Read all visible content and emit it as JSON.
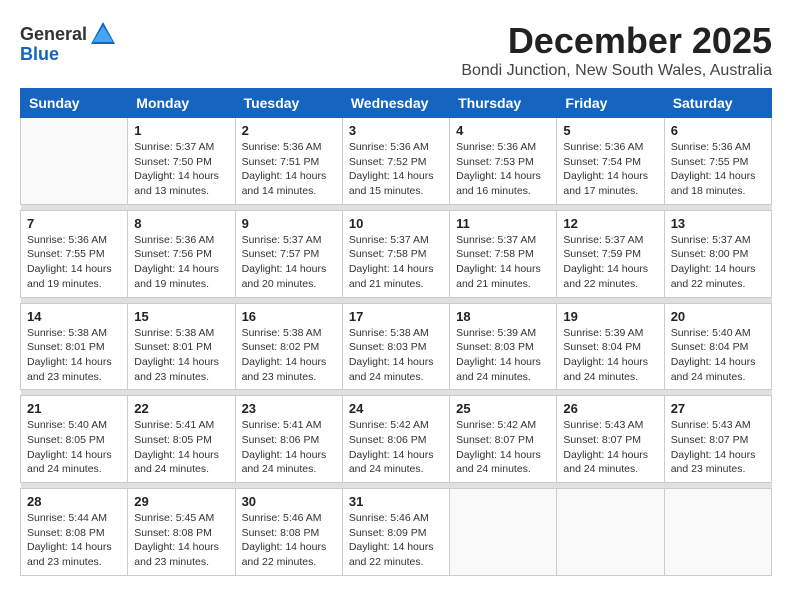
{
  "logo": {
    "general": "General",
    "blue": "Blue"
  },
  "title": "December 2025",
  "subtitle": "Bondi Junction, New South Wales, Australia",
  "headers": [
    "Sunday",
    "Monday",
    "Tuesday",
    "Wednesday",
    "Thursday",
    "Friday",
    "Saturday"
  ],
  "weeks": [
    [
      {
        "day": "",
        "info": ""
      },
      {
        "day": "1",
        "info": "Sunrise: 5:37 AM\nSunset: 7:50 PM\nDaylight: 14 hours\nand 13 minutes."
      },
      {
        "day": "2",
        "info": "Sunrise: 5:36 AM\nSunset: 7:51 PM\nDaylight: 14 hours\nand 14 minutes."
      },
      {
        "day": "3",
        "info": "Sunrise: 5:36 AM\nSunset: 7:52 PM\nDaylight: 14 hours\nand 15 minutes."
      },
      {
        "day": "4",
        "info": "Sunrise: 5:36 AM\nSunset: 7:53 PM\nDaylight: 14 hours\nand 16 minutes."
      },
      {
        "day": "5",
        "info": "Sunrise: 5:36 AM\nSunset: 7:54 PM\nDaylight: 14 hours\nand 17 minutes."
      },
      {
        "day": "6",
        "info": "Sunrise: 5:36 AM\nSunset: 7:55 PM\nDaylight: 14 hours\nand 18 minutes."
      }
    ],
    [
      {
        "day": "7",
        "info": "Sunrise: 5:36 AM\nSunset: 7:55 PM\nDaylight: 14 hours\nand 19 minutes."
      },
      {
        "day": "8",
        "info": "Sunrise: 5:36 AM\nSunset: 7:56 PM\nDaylight: 14 hours\nand 19 minutes."
      },
      {
        "day": "9",
        "info": "Sunrise: 5:37 AM\nSunset: 7:57 PM\nDaylight: 14 hours\nand 20 minutes."
      },
      {
        "day": "10",
        "info": "Sunrise: 5:37 AM\nSunset: 7:58 PM\nDaylight: 14 hours\nand 21 minutes."
      },
      {
        "day": "11",
        "info": "Sunrise: 5:37 AM\nSunset: 7:58 PM\nDaylight: 14 hours\nand 21 minutes."
      },
      {
        "day": "12",
        "info": "Sunrise: 5:37 AM\nSunset: 7:59 PM\nDaylight: 14 hours\nand 22 minutes."
      },
      {
        "day": "13",
        "info": "Sunrise: 5:37 AM\nSunset: 8:00 PM\nDaylight: 14 hours\nand 22 minutes."
      }
    ],
    [
      {
        "day": "14",
        "info": "Sunrise: 5:38 AM\nSunset: 8:01 PM\nDaylight: 14 hours\nand 23 minutes."
      },
      {
        "day": "15",
        "info": "Sunrise: 5:38 AM\nSunset: 8:01 PM\nDaylight: 14 hours\nand 23 minutes."
      },
      {
        "day": "16",
        "info": "Sunrise: 5:38 AM\nSunset: 8:02 PM\nDaylight: 14 hours\nand 23 minutes."
      },
      {
        "day": "17",
        "info": "Sunrise: 5:38 AM\nSunset: 8:03 PM\nDaylight: 14 hours\nand 24 minutes."
      },
      {
        "day": "18",
        "info": "Sunrise: 5:39 AM\nSunset: 8:03 PM\nDaylight: 14 hours\nand 24 minutes."
      },
      {
        "day": "19",
        "info": "Sunrise: 5:39 AM\nSunset: 8:04 PM\nDaylight: 14 hours\nand 24 minutes."
      },
      {
        "day": "20",
        "info": "Sunrise: 5:40 AM\nSunset: 8:04 PM\nDaylight: 14 hours\nand 24 minutes."
      }
    ],
    [
      {
        "day": "21",
        "info": "Sunrise: 5:40 AM\nSunset: 8:05 PM\nDaylight: 14 hours\nand 24 minutes."
      },
      {
        "day": "22",
        "info": "Sunrise: 5:41 AM\nSunset: 8:05 PM\nDaylight: 14 hours\nand 24 minutes."
      },
      {
        "day": "23",
        "info": "Sunrise: 5:41 AM\nSunset: 8:06 PM\nDaylight: 14 hours\nand 24 minutes."
      },
      {
        "day": "24",
        "info": "Sunrise: 5:42 AM\nSunset: 8:06 PM\nDaylight: 14 hours\nand 24 minutes."
      },
      {
        "day": "25",
        "info": "Sunrise: 5:42 AM\nSunset: 8:07 PM\nDaylight: 14 hours\nand 24 minutes."
      },
      {
        "day": "26",
        "info": "Sunrise: 5:43 AM\nSunset: 8:07 PM\nDaylight: 14 hours\nand 24 minutes."
      },
      {
        "day": "27",
        "info": "Sunrise: 5:43 AM\nSunset: 8:07 PM\nDaylight: 14 hours\nand 23 minutes."
      }
    ],
    [
      {
        "day": "28",
        "info": "Sunrise: 5:44 AM\nSunset: 8:08 PM\nDaylight: 14 hours\nand 23 minutes."
      },
      {
        "day": "29",
        "info": "Sunrise: 5:45 AM\nSunset: 8:08 PM\nDaylight: 14 hours\nand 23 minutes."
      },
      {
        "day": "30",
        "info": "Sunrise: 5:46 AM\nSunset: 8:08 PM\nDaylight: 14 hours\nand 22 minutes."
      },
      {
        "day": "31",
        "info": "Sunrise: 5:46 AM\nSunset: 8:09 PM\nDaylight: 14 hours\nand 22 minutes."
      },
      {
        "day": "",
        "info": ""
      },
      {
        "day": "",
        "info": ""
      },
      {
        "day": "",
        "info": ""
      }
    ]
  ]
}
